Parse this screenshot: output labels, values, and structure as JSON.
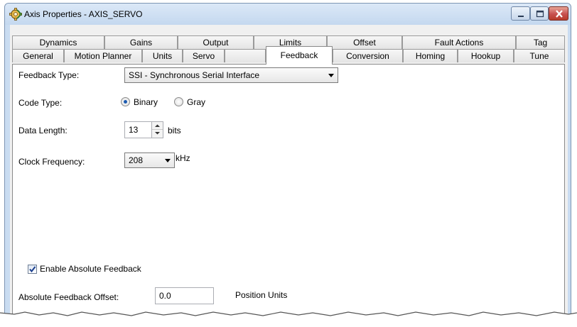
{
  "window": {
    "title": "Axis Properties - AXIS_SERVO"
  },
  "tabs_row_back": [
    "Dynamics",
    "Gains",
    "Output",
    "Limits",
    "Offset",
    "Fault Actions",
    "Tag"
  ],
  "tabs_row_front": [
    "General",
    "Motion Planner",
    "Units",
    "Servo",
    "Feedback",
    "Conversion",
    "Homing",
    "Hookup",
    "Tune"
  ],
  "active_tab": "Feedback",
  "form": {
    "feedback_type_label": "Feedback Type:",
    "feedback_type_value": "SSI - Synchronous Serial Interface",
    "code_type_label": "Code Type:",
    "code_type_options": [
      "Binary",
      "Gray"
    ],
    "code_type_selected": "Binary",
    "data_length_label": "Data Length:",
    "data_length_value": "13",
    "data_length_unit": "bits",
    "clock_frequency_label": "Clock Frequency:",
    "clock_frequency_value": "208",
    "clock_frequency_unit": "kHz",
    "enable_absolute_feedback_label": "Enable Absolute Feedback",
    "enable_absolute_feedback_checked": true,
    "absolute_feedback_offset_label": "Absolute Feedback Offset:",
    "absolute_feedback_offset_value": "0.0",
    "absolute_feedback_offset_unit": "Position Units"
  },
  "icons": [
    "gear-icon",
    "minimize-icon",
    "maximize-icon",
    "close-icon",
    "chevron-down-icon",
    "spin-up-icon",
    "spin-down-icon",
    "checkmark-icon"
  ]
}
